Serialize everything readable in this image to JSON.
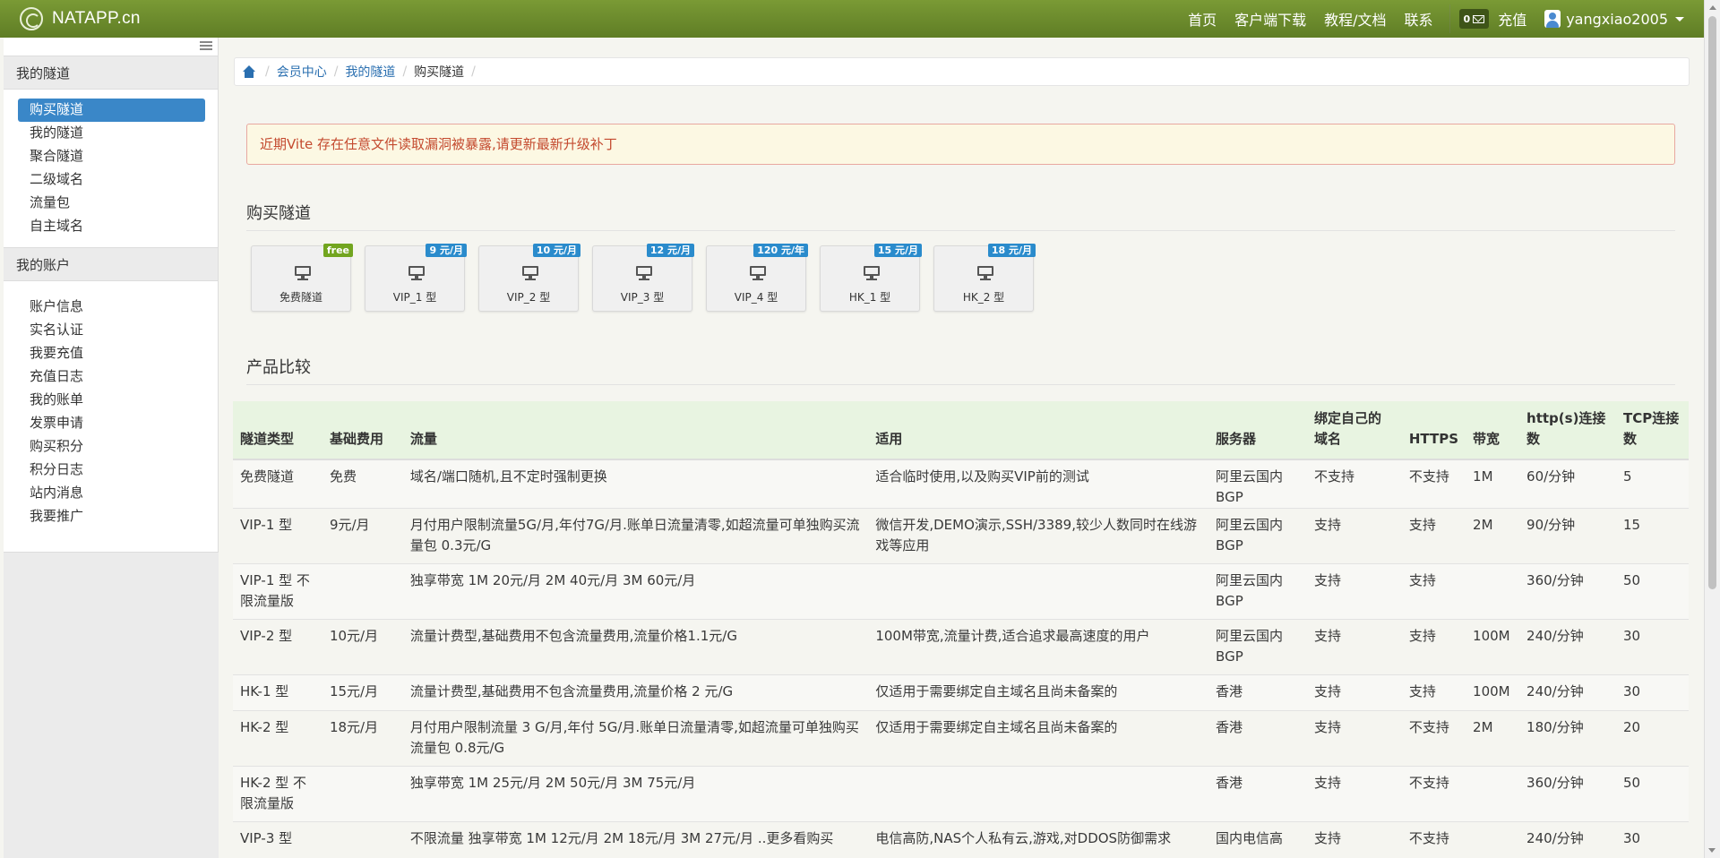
{
  "navbar": {
    "brand": "NATAPP.cn",
    "links": [
      "首页",
      "客户端下载",
      "教程/文档",
      "联系"
    ],
    "message_count": "0",
    "recharge": "充值",
    "username": "yangxiao2005"
  },
  "sidebar": {
    "section1": {
      "title": "我的隧道",
      "items": [
        "购买隧道",
        "我的隧道",
        "聚合隧道",
        "二级域名",
        "流量包",
        "自主域名"
      ]
    },
    "section2": {
      "title": "我的账户",
      "items": [
        "账户信息",
        "实名认证",
        "我要充值",
        "充值日志",
        "我的账单",
        "发票申请",
        "购买积分",
        "积分日志",
        "站内消息",
        "我要推广"
      ]
    }
  },
  "breadcrumb": {
    "items": [
      "会员中心",
      "我的隧道"
    ],
    "current": "购买隧道"
  },
  "alert": {
    "text": "近期Vite 存在任意文件读取漏洞被暴露,请更新最新升级补丁"
  },
  "buy": {
    "title": "购买隧道",
    "tiles": [
      {
        "label": "免费隧道",
        "badge": "free"
      },
      {
        "label": "VIP_1 型",
        "badge": "9 元/月"
      },
      {
        "label": "VIP_2 型",
        "badge": "10 元/月"
      },
      {
        "label": "VIP_3 型",
        "badge": "12 元/月"
      },
      {
        "label": "VIP_4 型",
        "badge": "120 元/年"
      },
      {
        "label": "HK_1 型",
        "badge": "15 元/月"
      },
      {
        "label": "HK_2 型",
        "badge": "18 元/月"
      }
    ]
  },
  "compare": {
    "title": "产品比较",
    "headers": [
      "隧道类型",
      "基础费用",
      "流量",
      "适用",
      "服务器",
      "绑定自己的域名",
      "HTTPS",
      "带宽",
      "http(s)连接数",
      "TCP连接数"
    ],
    "rows": [
      [
        "免费隧道",
        "免费",
        "域名/端口随机,且不定时强制更换",
        "适合临时使用,以及购买VIP前的测试",
        "阿里云国内BGP",
        "不支持",
        "不支持",
        "1M",
        "60/分钟",
        "5"
      ],
      [
        "VIP-1 型",
        "9元/月",
        "月付用户限制流量5G/月,年付7G/月.账单日流量清零,如超流量可单独购买流量包 0.3元/G",
        "微信开发,DEMO演示,SSH/3389,较少人数同时在线游戏等应用",
        "阿里云国内BGP",
        "支持",
        "支持",
        "2M",
        "90/分钟",
        "15"
      ],
      [
        "VIP-1 型 不限流量版",
        "",
        "独享带宽 1M 20元/月 2M 40元/月 3M 60元/月",
        "",
        "阿里云国内BGP",
        "支持",
        "支持",
        "",
        "360/分钟",
        "50"
      ],
      [
        "VIP-2 型",
        "10元/月",
        "流量计费型,基础费用不包含流量费用,流量价格1.1元/G",
        "100M带宽,流量计费,适合追求最高速度的用户",
        "阿里云国内BGP",
        "支持",
        "支持",
        "100M",
        "240/分钟",
        "30"
      ],
      [
        "HK-1 型",
        "15元/月",
        "流量计费型,基础费用不包含流量费用,流量价格 2 元/G",
        "仅适用于需要绑定自主域名且尚未备案的",
        "香港",
        "支持",
        "支持",
        "100M",
        "240/分钟",
        "30"
      ],
      [
        "HK-2 型",
        "18元/月",
        "月付用户限制流量 3 G/月,年付 5G/月.账单日流量清零,如超流量可单独购买流量包 0.8元/G",
        "仅适用于需要绑定自主域名且尚未备案的",
        "香港",
        "支持",
        "不支持",
        "2M",
        "180/分钟",
        "20"
      ],
      [
        "HK-2 型 不限流量版",
        "",
        "独享带宽 1M 25元/月 2M 50元/月 3M 75元/月",
        "",
        "香港",
        "支持",
        "不支持",
        "",
        "360/分钟",
        "50"
      ],
      [
        "VIP-3 型",
        "",
        "不限流量 独享带宽 1M 12元/月 2M 18元/月 3M 27元/月 ..更多看购买",
        "电信高防,NAS个人私有云,游戏,对DDOS防御需求",
        "国内电信高",
        "支持",
        "不支持",
        "",
        "240/分钟",
        "30"
      ]
    ]
  }
}
